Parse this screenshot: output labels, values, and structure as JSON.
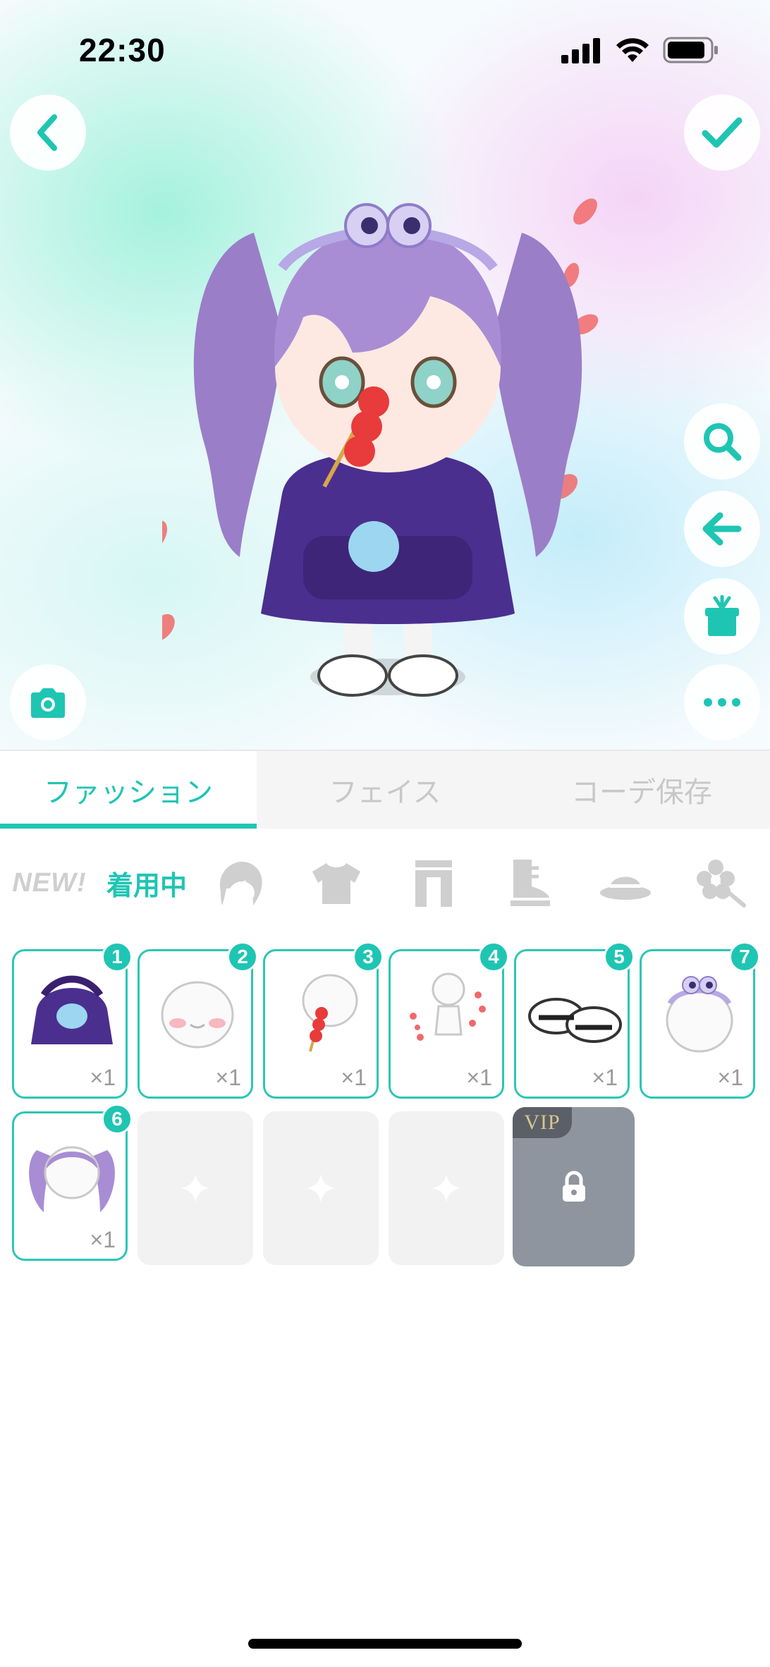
{
  "status_bar": {
    "time": "22:30"
  },
  "main_tabs": [
    {
      "label": "ファッション",
      "active": true
    },
    {
      "label": "フェイス",
      "active": false
    },
    {
      "label": "コーデ保存",
      "active": false
    }
  ],
  "categories": {
    "new_label": "NEW!",
    "wearing_label": "着用中",
    "icons": [
      "hair-icon",
      "tops-icon",
      "bottoms-icon",
      "shoes-icon",
      "hat-icon",
      "accessory-icon"
    ]
  },
  "items": [
    {
      "badge": "1",
      "qty": "×1",
      "icon": "purple-hoodie-icon"
    },
    {
      "badge": "2",
      "qty": "×1",
      "icon": "blush-face-icon"
    },
    {
      "badge": "3",
      "qty": "×1",
      "icon": "candied-strawberry-icon"
    },
    {
      "badge": "4",
      "qty": "×1",
      "icon": "petal-effect-icon"
    },
    {
      "badge": "5",
      "qty": "×1",
      "icon": "white-sneakers-icon"
    },
    {
      "badge": "7",
      "qty": "×1",
      "icon": "eyeball-headband-icon"
    },
    {
      "badge": "6",
      "qty": "×1",
      "icon": "purple-twintails-icon"
    }
  ],
  "vip_slot": {
    "label": "VIP"
  },
  "colors": {
    "accent": "#1fc5b3",
    "vip_bg": "#8f959e",
    "vip_text": "#d9c58c"
  }
}
